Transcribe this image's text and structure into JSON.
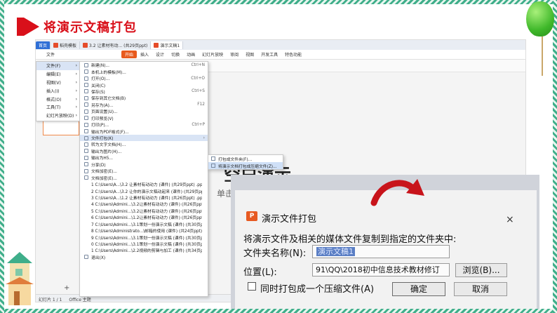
{
  "slide": {
    "title": "将演示文稿打包",
    "accent_color": "#d9101a"
  },
  "app": {
    "tabs": [
      {
        "label": "首页"
      },
      {
        "label": "稻壳模板"
      },
      {
        "label": "3.2 让素材有动... (共29页ppt)"
      },
      {
        "label": "演示文稿1"
      }
    ],
    "ribbon": [
      "文件",
      "开始",
      "插入",
      "设计",
      "切换",
      "动画",
      "幻灯片放映",
      "审阅",
      "视图",
      "开发工具",
      "特色功能"
    ],
    "ribbon_active": "开始",
    "slide_title_partial": "单击此处添加标题",
    "slide_big_text": "空白演示",
    "status": {
      "slide_count": "幻灯片 1 / 1",
      "theme": "Office 主题"
    }
  },
  "menu_level1": [
    {
      "label": "文件(F)",
      "arrow": "›"
    },
    {
      "label": "编辑(E)",
      "arrow": "›"
    },
    {
      "label": "视图(V)",
      "arrow": "›"
    },
    {
      "label": "插入(I)",
      "arrow": "›"
    },
    {
      "label": "格式(O)",
      "arrow": "›"
    },
    {
      "label": "工具(T)",
      "arrow": "›"
    },
    {
      "label": "幻灯片放映(D)",
      "arrow": "›"
    }
  ],
  "menu_level2": [
    {
      "label": "新建(N)...",
      "shortcut": "Ctrl+N"
    },
    {
      "label": "本机上的模板(M)...",
      "shortcut": ""
    },
    {
      "label": "打开(O)...",
      "shortcut": "Ctrl+O"
    },
    {
      "label": "关闭(C)",
      "shortcut": ""
    },
    {
      "label": "保存(S)",
      "shortcut": "Ctrl+S"
    },
    {
      "label": "保存到其它文档(B)",
      "shortcut": ""
    },
    {
      "label": "另存为(A)...",
      "shortcut": "F12"
    },
    {
      "label": "页面设置(U)...",
      "shortcut": ""
    },
    {
      "label": "打印预览(V)",
      "shortcut": ""
    },
    {
      "label": "打印(P)...",
      "shortcut": "Ctrl+P"
    },
    {
      "label": "输出为PDF格式(F)...",
      "shortcut": ""
    },
    {
      "label": "文件打包(K)",
      "shortcut": "›"
    },
    {
      "label": "转为文字文档(H)...",
      "shortcut": ""
    },
    {
      "label": "输出为图片(H)...",
      "shortcut": ""
    },
    {
      "label": "输出为H5...",
      "shortcut": ""
    },
    {
      "label": "分享(D)",
      "shortcut": ""
    },
    {
      "label": "文档加密(E)...",
      "shortcut": ""
    },
    {
      "label": "文档加密(E)...",
      "shortcut": ""
    },
    {
      "label": "1 C:\\Users\\A...\\3.2 让素材有动动力 (课件) (共29页ppt) .pp...",
      "shortcut": ""
    },
    {
      "label": "2 C:\\Users\\A...\\3.2 让你的演示文稿动起来 (课件) (共29页ppt...",
      "shortcut": ""
    },
    {
      "label": "3 C:\\Users\\A...\\1.2 让素材有动动力 (课件) (共26页ppt) .pp...",
      "shortcut": ""
    },
    {
      "label": "4 C:\\Users\\Admini...\\3.2让素材有动动力 (课件) (共26页ppt...",
      "shortcut": ""
    },
    {
      "label": "5 C:\\Users\\Admini...\\3.2让素材有动动力 (课件) (共26页ppt...",
      "shortcut": ""
    },
    {
      "label": "6 C:\\Users\\Admini...\\1.2让素材有动动力 (课件) (共26页ppt...",
      "shortcut": ""
    },
    {
      "label": "7 C:\\Users\\Admini...\\3.1策划一份演示文稿 (课件) (共30页ppt...",
      "shortcut": ""
    },
    {
      "label": "8 C:\\Users\\Administrato...\\邮箱的使用 (课件) (共24页ppt)...",
      "shortcut": ""
    },
    {
      "label": "9 C:\\Users\\Admini...\\3.1策划一份演示文稿 (课件) (共30页ppt...",
      "shortcut": ""
    },
    {
      "label": "0 C:\\Users\\Admini...\\3.1策划一份演示文稿 (课件) (共30页ppt...",
      "shortcut": ""
    },
    {
      "label": "1 C:\\Users\\Admini...\\2.2视频的剪辑与加工 (课件) (共34页ppt...",
      "shortcut": ""
    },
    {
      "label": "退出(X)",
      "shortcut": ""
    }
  ],
  "menu_level3": [
    {
      "label": "打包成文件夹(F)..."
    },
    {
      "label": "将演示文档打包成压缩文件(Z)..."
    }
  ],
  "dialog": {
    "title": "演示文件打包",
    "close": "×",
    "description": "将演示文件及相关的媒体文件复制到指定的文件夹中:",
    "folder_label": "文件夹名称(N):",
    "folder_value": "演示文稿1",
    "location_label": "位置(L):",
    "location_value": "91\\QQ\\2018初中信息技术教材修订",
    "browse": "浏览(B)...",
    "checkbox_label": "同时打包成一个压缩文件(A)",
    "ok": "确定",
    "cancel": "取消",
    "brand_icon": "wps-logo-icon"
  }
}
